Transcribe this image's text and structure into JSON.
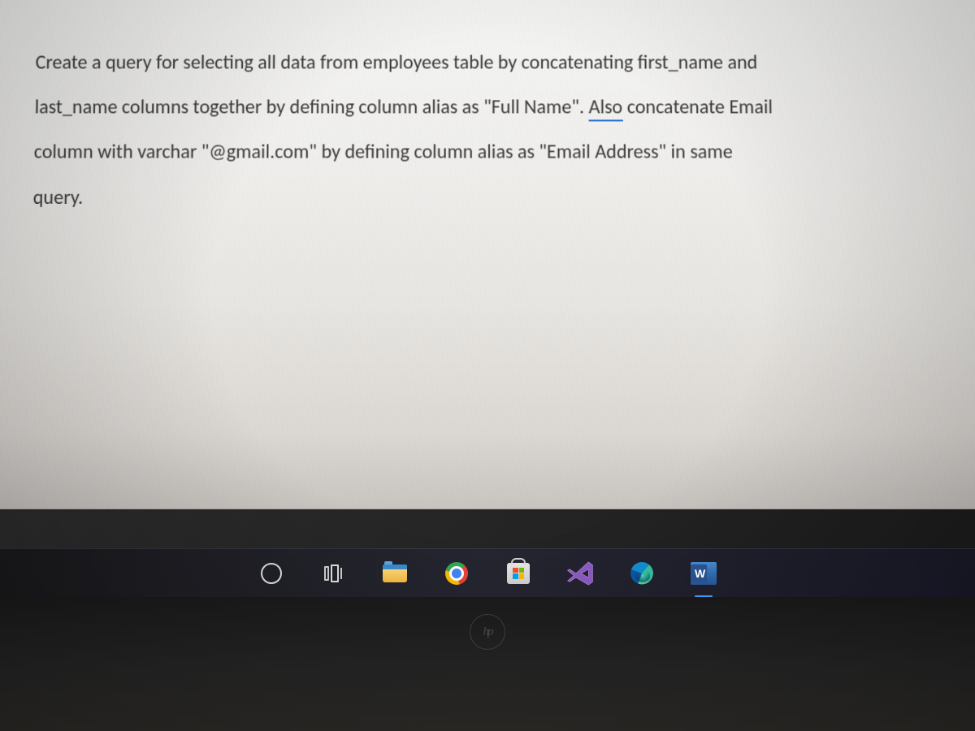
{
  "document": {
    "line1_pre": "Create a query for selecting all data from employees table by concatenating ",
    "line1_err": "first_name",
    "line1_post": " and",
    "line2_err": "last_name",
    "line2_mid": " columns together by defining column alias as \"Full Name\". ",
    "line2_gram": "Also",
    "line2_post": " concatenate Email",
    "line3_pre": "column with ",
    "line3_err": "varchar",
    "line3_post": " \"@gmail.com\" by defining column alias as \"Email Address\" in same",
    "line4": "query."
  },
  "taskbar": {
    "cortana_name": "cortana",
    "taskview_name": "task-view",
    "explorer_name": "file-explorer",
    "chrome_name": "google-chrome",
    "store_name": "microsoft-store",
    "vscode_name": "visual-studio",
    "edge_name": "microsoft-edge",
    "word_name": "microsoft-word",
    "word_letter": "W"
  },
  "brand": {
    "hp": "hp"
  }
}
